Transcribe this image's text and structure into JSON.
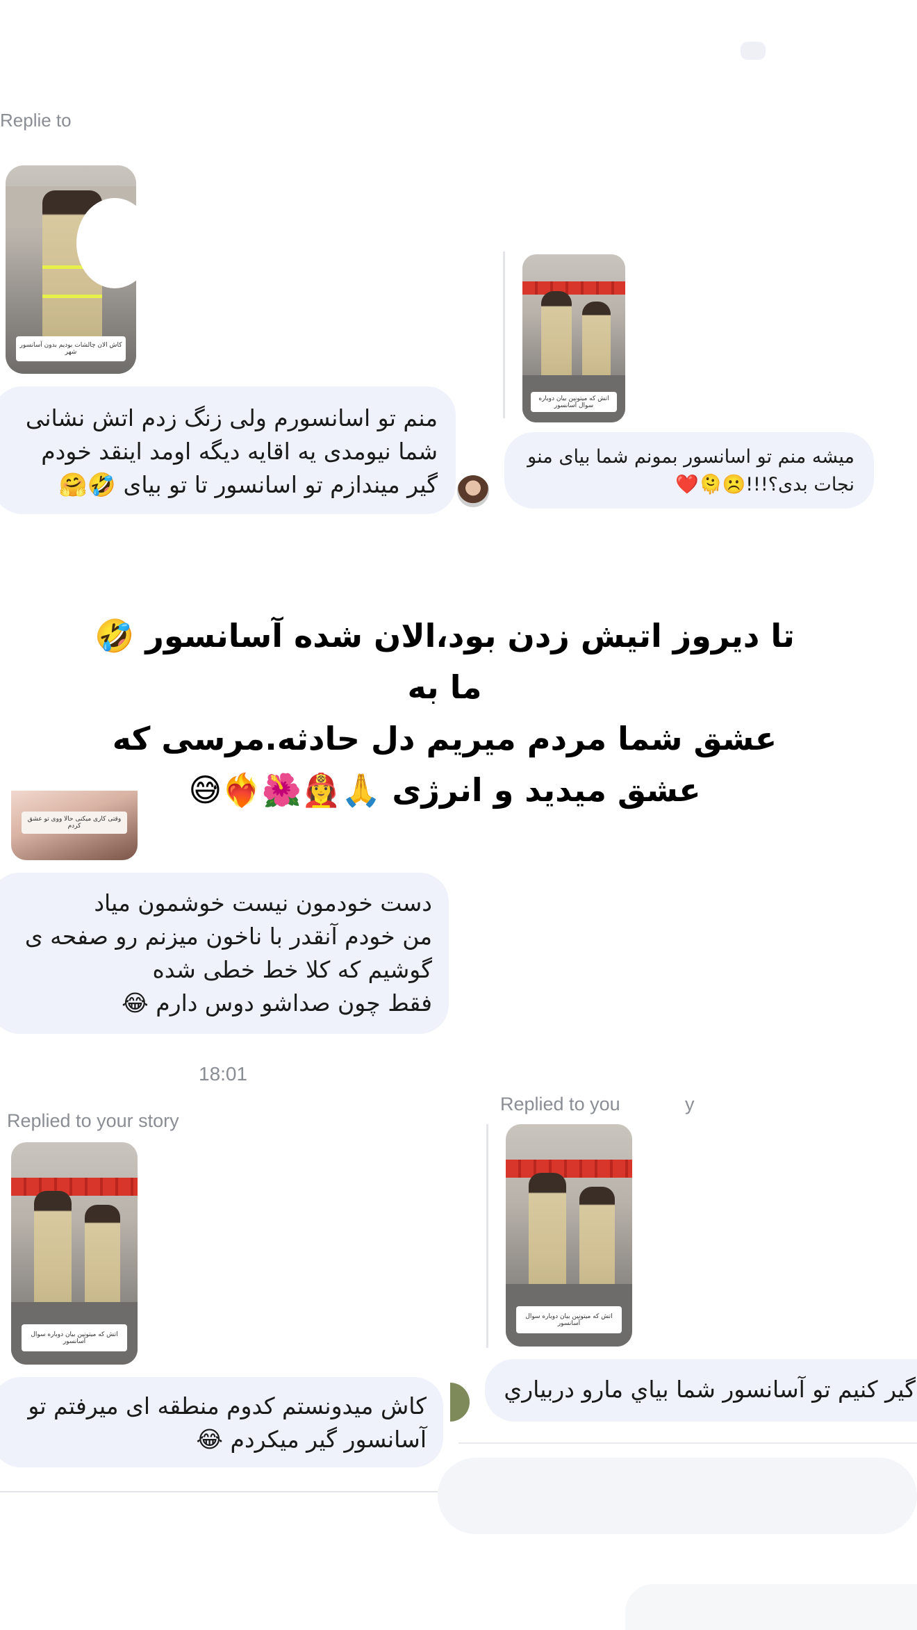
{
  "screenshot": {
    "replying_partial": "Replie​ to",
    "left1": {
      "thumb_caption": "کاش الان چالشات بودیم بدون آسانسور شهر",
      "text": "منم تو اسانسورم ولی زنگ زدم اتش نشانی\nشما نیومدی یه اقایه دیگه اومد اینقد خودم\nگیر میندازم تو اسانسور تا تو بیای 🤣🤗"
    },
    "right1": {
      "thumb_caption": "اتش که میتونین بیان دوباره سوال آسانسور",
      "text": "میشه منم تو اسانسور بمونم شما بیای منو\nنجات بدی؟!!!☹️🫠❤️"
    },
    "headline": "تا دیروز اتیش زدن بود،الان شده آسانسور 🤣ما به\nعشق شما مردم میریم دل حادثه.مرسی که\nعشق میدید و انرژی 🙏👩‍🚒🌺❤️‍🔥😅",
    "left2": {
      "thumb_caption": "وقتی کاری میکنی حالا ووی تو عشق کردم",
      "text": "دست خودمون نیست خوشمون میاد\nمن خودم آنقدر با ناخون میزنم رو صفحه ی\nگوشیم که کلا خط خطی شده\nفقط چون صداشو دوس دارم 😂"
    },
    "time": "18:01",
    "left3": {
      "meta": "Replied to your story",
      "thumb_caption": "اتش که میتونین بیان دوباره سوال آسانسور",
      "text": "کاش میدونستم کدوم منطقه ای میرفتم تو\nآسانسور گیر میکردم 😂"
    },
    "right3": {
      "meta": "Replied to you",
      "meta_tail": "y",
      "thumb_caption": "اتش که میتونین بیان دوباره سوال آسانسور",
      "text": "گیر کنیم تو آسانسور شما بیاي مارو دربياري"
    }
  }
}
